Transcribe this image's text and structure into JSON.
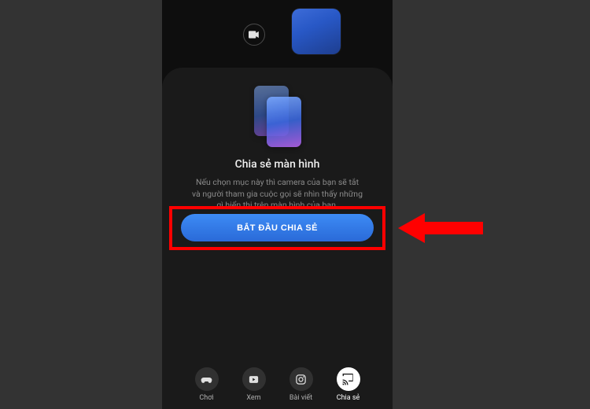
{
  "topbar": {
    "camera_icon": "camera-icon"
  },
  "panel": {
    "title": "Chia sẻ màn hình",
    "desc_line1": "Nếu chọn mục này thì camera của bạn sẽ tắt",
    "desc_line2": "và người tham gia cuộc gọi sẽ nhìn thấy những",
    "desc_line3": "gì hiển thị trên màn hình của bạn.",
    "cta_label": "BẮT ĐẦU CHIA SẺ"
  },
  "tabs": {
    "play": "Chơi",
    "watch": "Xem",
    "post": "Bài viết",
    "share": "Chia sẻ"
  }
}
